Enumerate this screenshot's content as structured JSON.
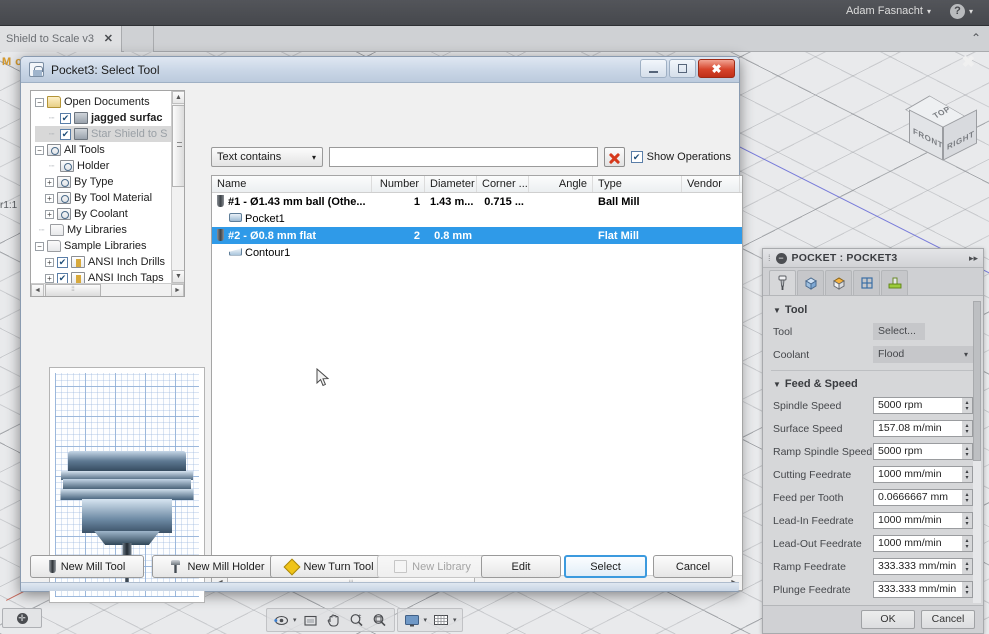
{
  "app": {
    "user": "Adam Fasnacht",
    "user_caret": "▾",
    "help_glyph": "?",
    "help_caret": "▾",
    "document_tab": "Shield to Scale v3",
    "tab_close": "✕",
    "panel_collapse": "⌃",
    "browser_fragment": "M o",
    "scale_fragment": "r1:1",
    "global_close": "✖"
  },
  "viewcube": {
    "top": "TOP",
    "front": "FRONT",
    "right": "RIGHT"
  },
  "navbar": {
    "items": [
      {
        "name": "orbit-icon",
        "glyph": "⟲"
      },
      {
        "name": "orbit-dropdown-icon",
        "glyph": "▾"
      },
      {
        "name": "look-at-icon",
        "glyph": "▤"
      },
      {
        "name": "pan-icon",
        "glyph": "✋"
      },
      {
        "name": "zoom-icon",
        "glyph": "🔍"
      },
      {
        "name": "fit-icon",
        "glyph": "⊕"
      }
    ],
    "display_icon": "🖵",
    "display_caret": "▾",
    "grid_icon": "▦",
    "grid_caret": "▾",
    "corner_pill": "✛"
  },
  "properties": {
    "title": "POCKET : POCKET3",
    "collapse_glyph": "−",
    "expand_glyph": "▸▸",
    "grip": "⁞",
    "tabs": [
      {
        "name": "tab-tool",
        "glyph": "⌶",
        "active": true
      },
      {
        "name": "tab-geometry",
        "glyph": "⬡",
        "active": false
      },
      {
        "name": "tab-heights",
        "glyph": "▱",
        "active": false
      },
      {
        "name": "tab-passes",
        "glyph": "⊟",
        "active": false
      },
      {
        "name": "tab-linking",
        "glyph": "⊔",
        "active": false
      }
    ],
    "sections": [
      {
        "title": "Tool",
        "arrow": "▼",
        "rows": [
          {
            "label": "Tool",
            "type": "button",
            "value": "Select..."
          },
          {
            "label": "Coolant",
            "type": "select",
            "value": "Flood",
            "caret": "▾"
          }
        ]
      },
      {
        "title": "Feed & Speed",
        "arrow": "▼",
        "rows": [
          {
            "label": "Spindle Speed",
            "type": "spinner",
            "value": "5000 rpm"
          },
          {
            "label": "Surface Speed",
            "type": "spinner",
            "value": "157.08 m/min"
          },
          {
            "label": "Ramp Spindle Speed",
            "type": "spinner",
            "value": "5000 rpm"
          },
          {
            "label": "Cutting Feedrate",
            "type": "spinner",
            "value": "1000 mm/min"
          },
          {
            "label": "Feed per Tooth",
            "type": "spinner",
            "value": "0.0666667 mm"
          },
          {
            "label": "Lead-In Feedrate",
            "type": "spinner",
            "value": "1000 mm/min"
          },
          {
            "label": "Lead-Out Feedrate",
            "type": "spinner",
            "value": "1000 mm/min"
          },
          {
            "label": "Ramp Feedrate",
            "type": "spinner",
            "value": "333.333 mm/min"
          },
          {
            "label": "Plunge Feedrate",
            "type": "spinner",
            "value": "333.333 mm/min"
          }
        ]
      }
    ],
    "footer": {
      "ok": "OK",
      "cancel": "Cancel"
    }
  },
  "dialog": {
    "title": "Pocket3: Select Tool",
    "window_buttons": {
      "minimize": "",
      "maximize": "",
      "close": "✖"
    },
    "tree": [
      {
        "indent": 0,
        "expander": "−",
        "icon": "folder-open",
        "label": "Open Documents",
        "checked": null,
        "style": "normal"
      },
      {
        "indent": 1,
        "expander": "",
        "icon": "doc",
        "label": "jagged surfac",
        "checked": true,
        "style": "bold"
      },
      {
        "indent": 1,
        "expander": "",
        "icon": "doc",
        "label": "Star Shield to S",
        "checked": true,
        "style": "dim-selected"
      },
      {
        "indent": 0,
        "expander": "−",
        "icon": "mag",
        "label": "All Tools",
        "checked": null,
        "style": "normal"
      },
      {
        "indent": 1,
        "expander": "",
        "icon": "mag",
        "label": "Holder",
        "checked": null,
        "style": "normal"
      },
      {
        "indent": 1,
        "expander": "+",
        "icon": "mag",
        "label": "By Type",
        "checked": null,
        "style": "normal"
      },
      {
        "indent": 1,
        "expander": "+",
        "icon": "mag",
        "label": "By Tool Material",
        "checked": null,
        "style": "normal"
      },
      {
        "indent": 1,
        "expander": "+",
        "icon": "mag",
        "label": "By Coolant",
        "checked": null,
        "style": "normal"
      },
      {
        "indent": 0,
        "expander": "",
        "icon": "folder-plain",
        "label": "My Libraries",
        "checked": null,
        "style": "normal"
      },
      {
        "indent": 0,
        "expander": "−",
        "icon": "folder-plain",
        "label": "Sample Libraries",
        "checked": null,
        "style": "normal"
      },
      {
        "indent": 1,
        "expander": "+",
        "icon": "lib",
        "label": "ANSI Inch Drills",
        "checked": true,
        "style": "normal"
      },
      {
        "indent": 1,
        "expander": "+",
        "icon": "lib",
        "label": "ANSI Inch Taps",
        "checked": true,
        "style": "normal"
      }
    ],
    "filter": {
      "mode": "Text contains",
      "mode_caret": "▾",
      "query": "",
      "query_placeholder": "",
      "clear_title": "Clear filter",
      "show_operations_label": "Show Operations",
      "show_operations_checked": "✔"
    },
    "table": {
      "columns": [
        {
          "key": "name",
          "label": "Name",
          "width": 160,
          "align": "left"
        },
        {
          "key": "number",
          "label": "Number",
          "width": 53,
          "align": "right"
        },
        {
          "key": "diameter",
          "label": "Diameter",
          "width": 52,
          "align": "right"
        },
        {
          "key": "corner",
          "label": "Corner ...",
          "width": 52,
          "align": "right"
        },
        {
          "key": "angle",
          "label": "Angle",
          "width": 64,
          "align": "right"
        },
        {
          "key": "type",
          "label": "Type",
          "width": 89,
          "align": "left"
        },
        {
          "key": "vendor",
          "label": "Vendor",
          "width": 58,
          "align": "left"
        }
      ],
      "rows": [
        {
          "kind": "tool",
          "selected": false,
          "name": "#1 - Ø1.43 mm ball (Othe...",
          "number": "1",
          "diameter": "1.43 m...",
          "corner": "0.715 ...",
          "angle": "",
          "type": "Ball Mill",
          "vendor": ""
        },
        {
          "kind": "operation",
          "selected": false,
          "name": "Pocket1",
          "number": "",
          "diameter": "",
          "corner": "",
          "angle": "",
          "type": "",
          "vendor": ""
        },
        {
          "kind": "tool",
          "selected": true,
          "name": "#2 - Ø0.8 mm flat",
          "number": "2",
          "diameter": "0.8 mm",
          "corner": "",
          "angle": "",
          "type": "Flat Mill",
          "vendor": ""
        },
        {
          "kind": "operation",
          "selected": false,
          "name": "Contour1",
          "number": "",
          "diameter": "",
          "corner": "",
          "angle": "",
          "type": "",
          "vendor": ""
        }
      ]
    },
    "buttons": [
      {
        "name": "new-mill-tool-button",
        "label": "New Mill Tool",
        "mnemonic": "T",
        "icon": "mill-tool-icon",
        "disabled": false,
        "default": false
      },
      {
        "name": "new-mill-holder-button",
        "label": "New Mill Holder",
        "mnemonic": "H",
        "icon": "mill-holder-icon",
        "disabled": false,
        "default": false
      },
      {
        "name": "new-turn-tool-button",
        "label": "New Turn Tool",
        "mnemonic": "u",
        "icon": "turn-tool-icon",
        "disabled": false,
        "default": false
      },
      {
        "name": "new-library-button",
        "label": "New Library",
        "mnemonic": "i",
        "icon": "library-icon",
        "disabled": true,
        "default": false
      },
      {
        "name": "edit-button",
        "label": "Edit",
        "mnemonic": "",
        "icon": "",
        "disabled": false,
        "default": false
      },
      {
        "name": "select-button",
        "label": "Select",
        "mnemonic": "",
        "icon": "",
        "disabled": false,
        "default": true
      },
      {
        "name": "cancel-button",
        "label": "Cancel",
        "mnemonic": "",
        "icon": "",
        "disabled": false,
        "default": false
      }
    ]
  }
}
